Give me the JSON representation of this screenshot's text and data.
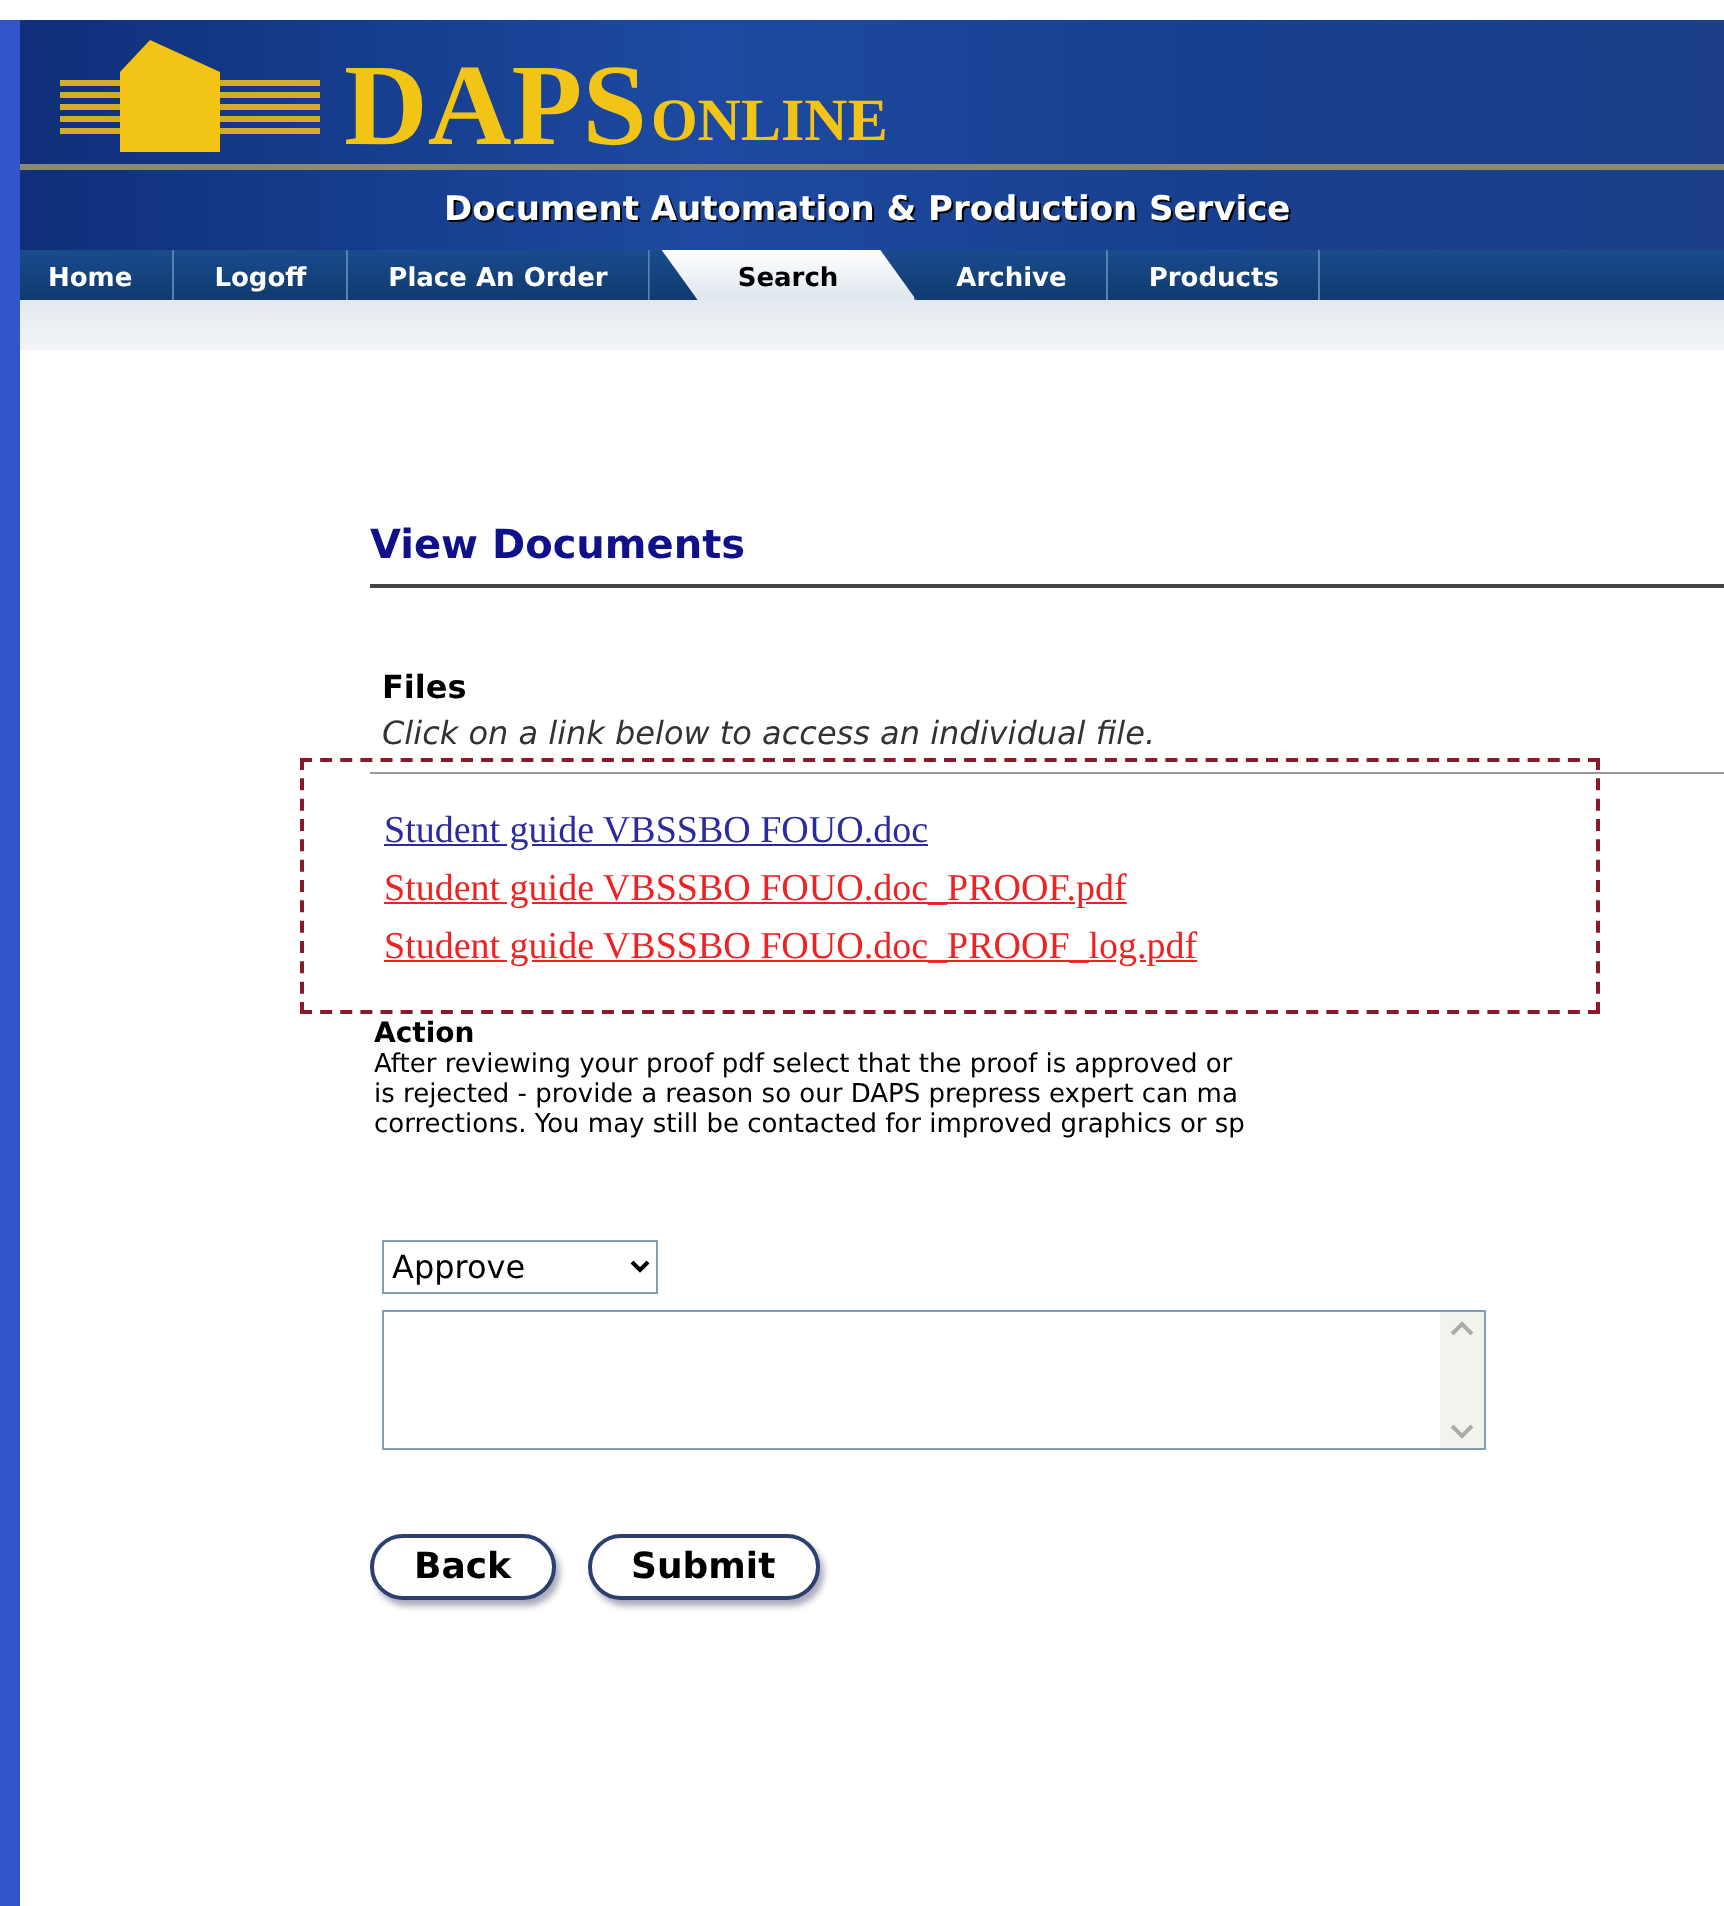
{
  "header": {
    "logo_main": "DAPS",
    "logo_sub": "ONLINE",
    "subtitle": "Document Automation & Production Service"
  },
  "nav": [
    {
      "label": "Home",
      "selected": false
    },
    {
      "label": "Logoff",
      "selected": false
    },
    {
      "label": "Place An Order",
      "selected": false
    },
    {
      "label": "Search",
      "selected": true
    },
    {
      "label": "Archive",
      "selected": false
    },
    {
      "label": "Products",
      "selected": false
    }
  ],
  "heading": "View Documents",
  "files": {
    "title": "Files",
    "hint": "Click on a link below to access an individual file.",
    "links": [
      {
        "label": "Student guide VBSSBO FOUO.doc",
        "color": "#2b2b9e"
      },
      {
        "label": "Student guide VBSSBO FOUO.doc_PROOF.pdf",
        "color": "#ee2222"
      },
      {
        "label": "Student guide VBSSBO FOUO.doc_PROOF_log.pdf",
        "color": "#ee2222"
      }
    ]
  },
  "action": {
    "title": "Action",
    "lines": [
      "After reviewing your proof pdf select that the proof is approved or",
      "is rejected - provide a reason so our DAPS prepress expert can ma",
      "corrections. You may still be contacted for improved graphics or sp"
    ],
    "select": "Approve"
  },
  "buttons": [
    "Back",
    "Submit"
  ]
}
